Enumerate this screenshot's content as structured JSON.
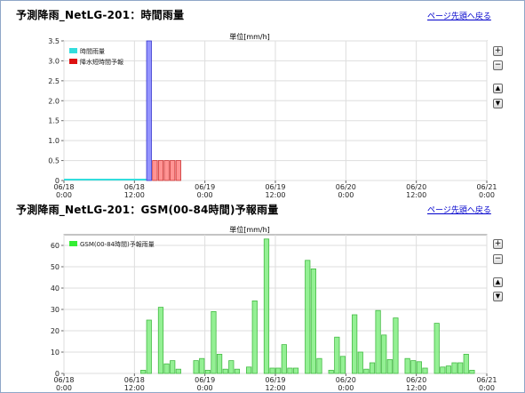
{
  "top_link": "ページ先頭へ戻る",
  "controls": {
    "zoom_in": "+",
    "zoom_out": "−",
    "scroll_up": "▲",
    "scroll_down": "▼"
  },
  "charts": [
    {
      "title": "予測降雨_NetLG-201：時間雨量",
      "unit": "単位[mm/h]",
      "legend": [
        {
          "label": "時間雨量",
          "color": "#33dddd"
        },
        {
          "label": "降水短時間予報",
          "color": "#dd1111"
        }
      ]
    },
    {
      "title": "予測降雨_NetLG-201：GSM(00-84時間)予報雨量",
      "unit": "単位[mm/h]",
      "legend": [
        {
          "label": "GSM(00-84時間)予報雨量",
          "color": "#33ee33"
        }
      ]
    }
  ],
  "chart_data": [
    {
      "type": "bar",
      "ylim": [
        0,
        3.5
      ],
      "yticks": [
        "0",
        "0.5",
        "1.0",
        "1.5",
        "2.0",
        "2.5",
        "3.0",
        "3.5"
      ],
      "x_range_hours": [
        0,
        72
      ],
      "x_ticks": [
        {
          "date": "06/18",
          "time": "0:00"
        },
        {
          "date": "06/18",
          "time": "12:00"
        },
        {
          "date": "06/19",
          "time": "0:00"
        },
        {
          "date": "06/19",
          "time": "12:00"
        },
        {
          "date": "06/20",
          "time": "0:00"
        },
        {
          "date": "06/20",
          "time": "12:00"
        },
        {
          "date": "06/21",
          "time": "0:00"
        }
      ],
      "observed_line": {
        "name": "時間雨量",
        "from_hour": 0,
        "to_hour": 14,
        "value": 0
      },
      "series": [
        {
          "name": "降水短時間予報",
          "color": "#ee7777",
          "hours": [
            14,
            15,
            16,
            17,
            18,
            19
          ],
          "values": [
            3.5,
            0.5,
            0.5,
            0.5,
            0.5,
            0.5
          ]
        }
      ],
      "grid": true
    },
    {
      "type": "bar",
      "ylim": [
        0,
        65
      ],
      "yticks": [
        "0",
        "10",
        "20",
        "30",
        "40",
        "50",
        "60"
      ],
      "x_range_hours": [
        0,
        72
      ],
      "x_ticks": [
        {
          "date": "06/18",
          "time": "0:00"
        },
        {
          "date": "06/18",
          "time": "12:00"
        },
        {
          "date": "06/19",
          "time": "0:00"
        },
        {
          "date": "06/19",
          "time": "12:00"
        },
        {
          "date": "06/20",
          "time": "0:00"
        },
        {
          "date": "06/20",
          "time": "12:00"
        },
        {
          "date": "06/21",
          "time": "0:00"
        }
      ],
      "series": [
        {
          "name": "GSM(00-84時間)予報雨量",
          "color": "#88ee88",
          "start_hour": 13,
          "values": [
            1.5,
            25,
            0,
            31,
            4.5,
            6,
            2,
            0,
            0,
            6,
            7,
            1.5,
            29,
            9,
            2,
            6,
            2,
            0,
            3,
            34,
            0,
            63,
            2.5,
            2.5,
            13.5,
            2.5,
            2.5,
            0,
            53,
            49,
            7,
            0,
            1.5,
            17,
            8,
            0,
            27.5,
            10,
            2,
            5,
            29.5,
            18,
            6.5,
            26,
            0,
            7,
            6,
            5.5,
            2.5,
            0,
            23.5,
            3,
            3.5,
            5,
            5,
            9,
            1.5
          ]
        }
      ],
      "grid": true
    }
  ]
}
